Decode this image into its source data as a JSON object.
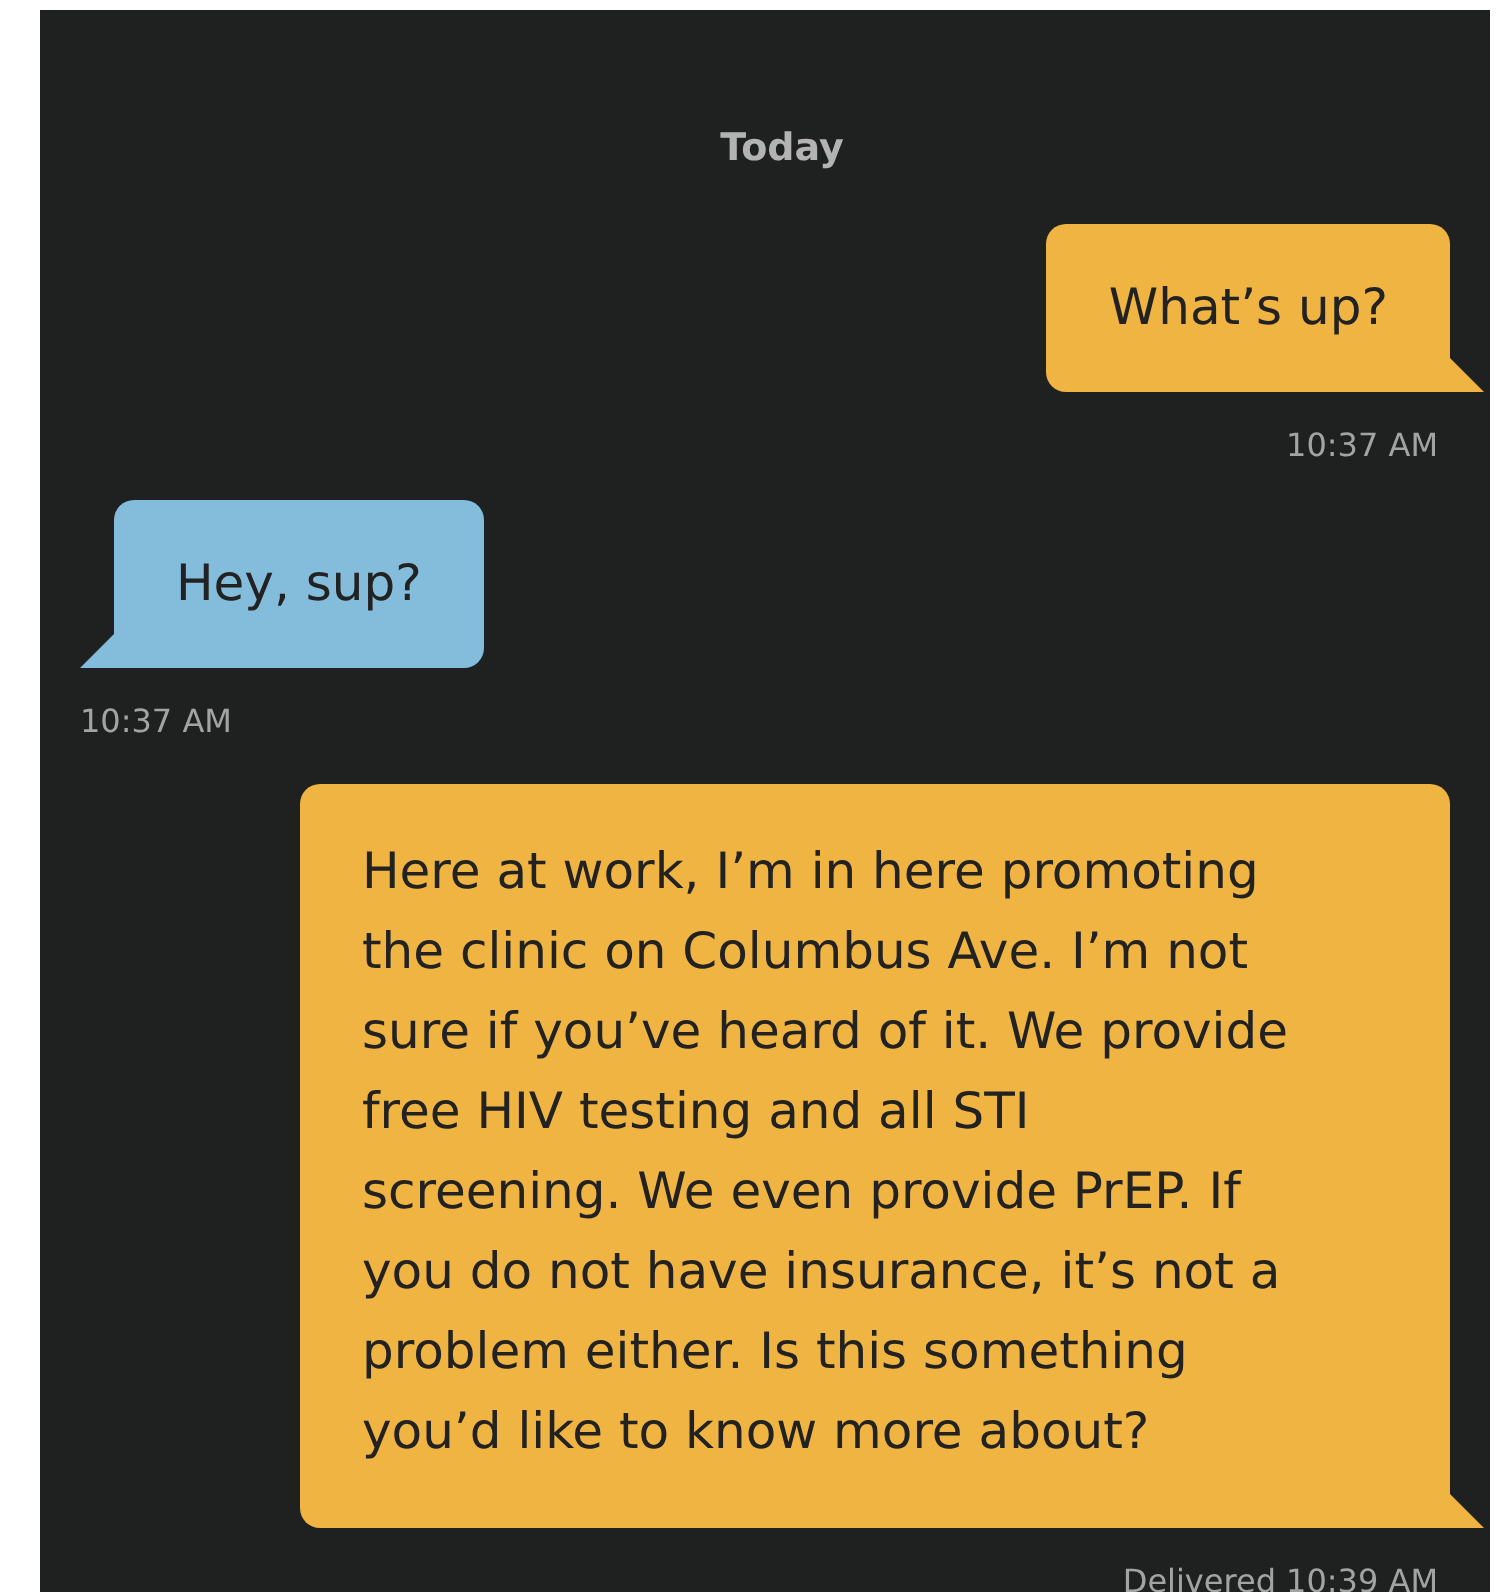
{
  "day_label": "Today",
  "messages": [
    {
      "kind": "outgoing",
      "lines": [
        "What’s up?"
      ],
      "meta": "10:37 AM"
    },
    {
      "kind": "incoming",
      "lines": [
        "Hey, sup?"
      ],
      "meta": "10:37 AM"
    },
    {
      "kind": "outgoing",
      "lines": [
        "Here at work, I’m in here promoting",
        "the clinic on Columbus Ave. I’m not",
        "sure if you’ve heard of it. We provide",
        "free HIV testing and all STI",
        "screening. We even provide PrEP. If",
        "you do not have insurance, it’s not a",
        "problem either. Is this something",
        "you’d like to know more about?"
      ],
      "meta": "Delivered 10:39 AM"
    }
  ]
}
